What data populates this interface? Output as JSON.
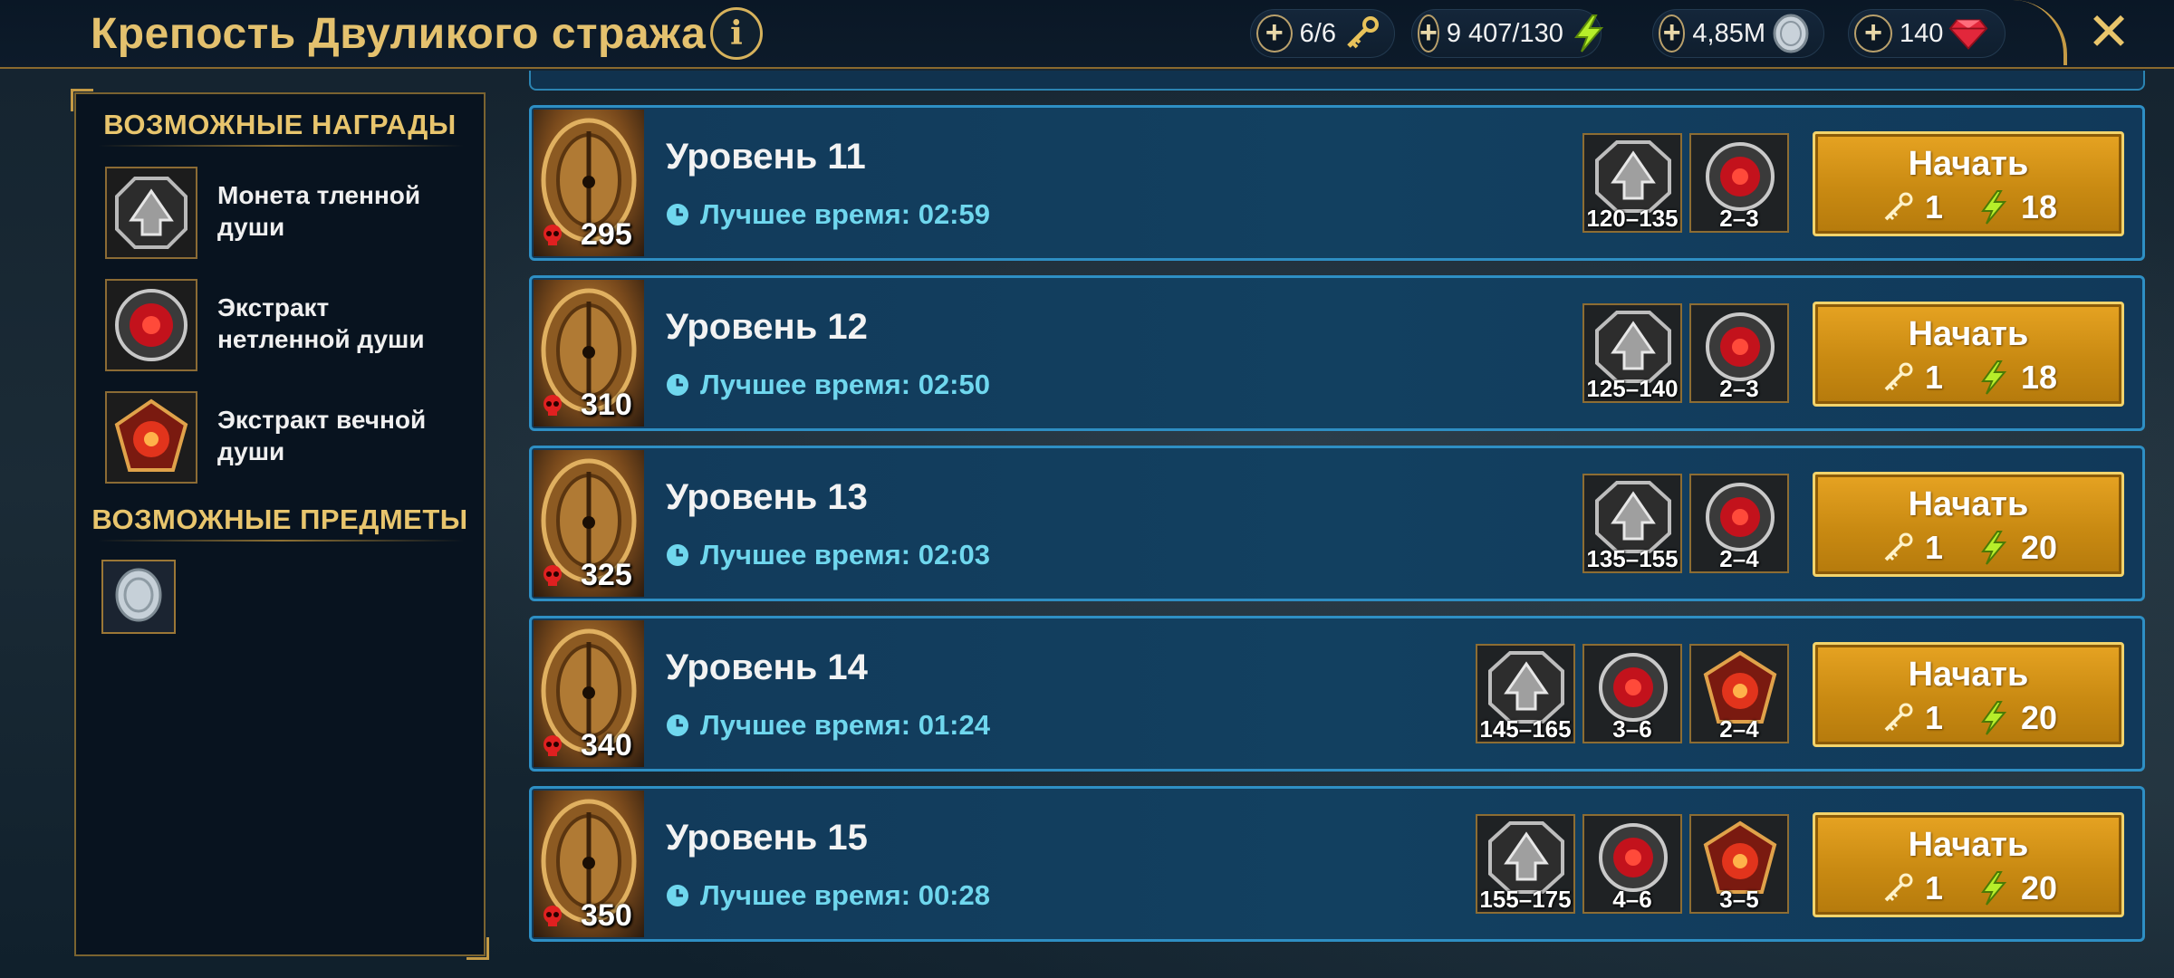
{
  "header": {
    "title": "Крепость Двуликого стража",
    "info_label": "i",
    "close_label": "✕",
    "resources": [
      {
        "name": "keys",
        "value": "6/6",
        "plus": "+"
      },
      {
        "name": "energy",
        "value": "9 407/130",
        "plus": "+"
      },
      {
        "name": "silver",
        "value": "4,85M",
        "plus": "+"
      },
      {
        "name": "gems",
        "value": "140",
        "plus": "+"
      }
    ]
  },
  "sidebar": {
    "rewards_title": "ВОЗМОЖНЫЕ НАГРАДЫ",
    "rewards": [
      {
        "name": "Монета тленной души",
        "icon": "perishable-soul-coin-icon"
      },
      {
        "name": "Экстракт нетленной души",
        "icon": "imperishable-soul-extract-icon"
      },
      {
        "name": "Экстракт вечной души",
        "icon": "eternal-soul-extract-icon"
      }
    ],
    "items_title": "ВОЗМОЖНЫЕ ПРЕДМЕТЫ",
    "items": [
      {
        "icon": "silver-coin-icon"
      }
    ]
  },
  "levels": [
    {
      "title": "Уровень 11",
      "power": "295",
      "best_time_label": "Лучшее время: 02:59",
      "drops": [
        {
          "type": "coin",
          "qty": "120–135"
        },
        {
          "type": "red",
          "qty": "2–3"
        }
      ],
      "start_label": "Начать",
      "key_cost": "1",
      "energy_cost": "18"
    },
    {
      "title": "Уровень 12",
      "power": "310",
      "best_time_label": "Лучшее время: 02:50",
      "drops": [
        {
          "type": "coin",
          "qty": "125–140"
        },
        {
          "type": "red",
          "qty": "2–3"
        }
      ],
      "start_label": "Начать",
      "key_cost": "1",
      "energy_cost": "18"
    },
    {
      "title": "Уровень 13",
      "power": "325",
      "best_time_label": "Лучшее время: 02:03",
      "drops": [
        {
          "type": "coin",
          "qty": "135–155"
        },
        {
          "type": "red",
          "qty": "2–4"
        }
      ],
      "start_label": "Начать",
      "key_cost": "1",
      "energy_cost": "20"
    },
    {
      "title": "Уровень 14",
      "power": "340",
      "best_time_label": "Лучшее время: 01:24",
      "drops": [
        {
          "type": "coin",
          "qty": "145–165"
        },
        {
          "type": "red",
          "qty": "3–6"
        },
        {
          "type": "eternal",
          "qty": "2–4"
        }
      ],
      "start_label": "Начать",
      "key_cost": "1",
      "energy_cost": "20"
    },
    {
      "title": "Уровень 15",
      "power": "350",
      "best_time_label": "Лучшее время: 00:28",
      "drops": [
        {
          "type": "coin",
          "qty": "155–175"
        },
        {
          "type": "red",
          "qty": "4–6"
        },
        {
          "type": "eternal",
          "qty": "3–5"
        }
      ],
      "start_label": "Начать",
      "key_cost": "1",
      "energy_cost": "20"
    }
  ],
  "colors": {
    "accent_gold": "#e4c16e",
    "row_border": "#2e8fc4",
    "best_time": "#6fd7ee",
    "button": "#d4961a"
  }
}
